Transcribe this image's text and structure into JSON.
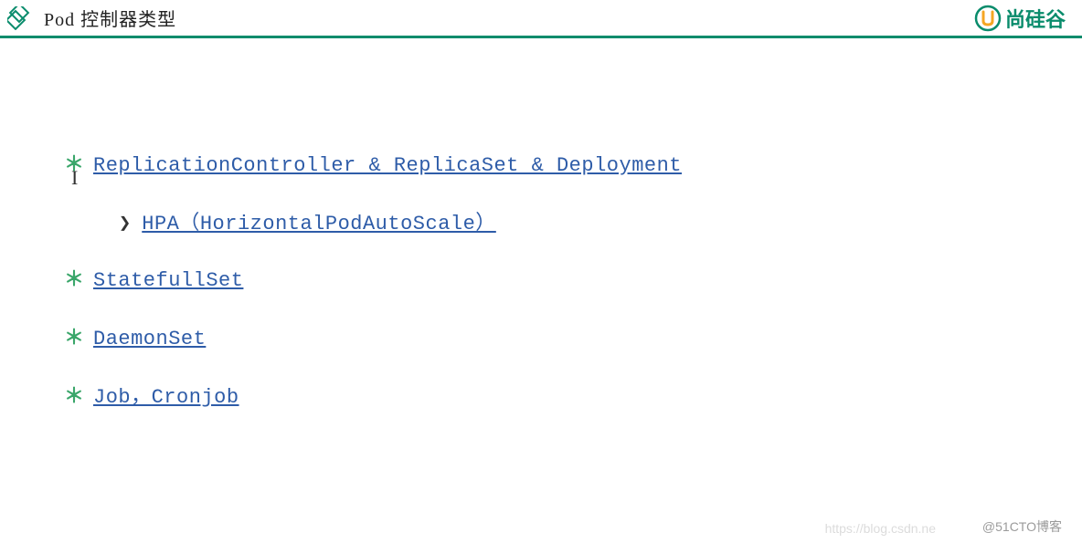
{
  "header": {
    "title": "Pod 控制器类型"
  },
  "brand": {
    "name": "尚硅谷"
  },
  "items": [
    {
      "bullet": "＊",
      "label": "ReplicationController & ReplicaSet & Deployment",
      "sub": {
        "arrow": "❯",
        "label": "HPA（HorizontalPodAutoScale）"
      }
    },
    {
      "bullet": "＊",
      "label": "StatefullSet"
    },
    {
      "bullet": "＊",
      "label": "DaemonSet"
    },
    {
      "bullet": "＊",
      "label": "Job，Cronjob"
    }
  ],
  "watermark": {
    "left": "https://blog.csdn.ne",
    "right": "@51CTO博客"
  }
}
